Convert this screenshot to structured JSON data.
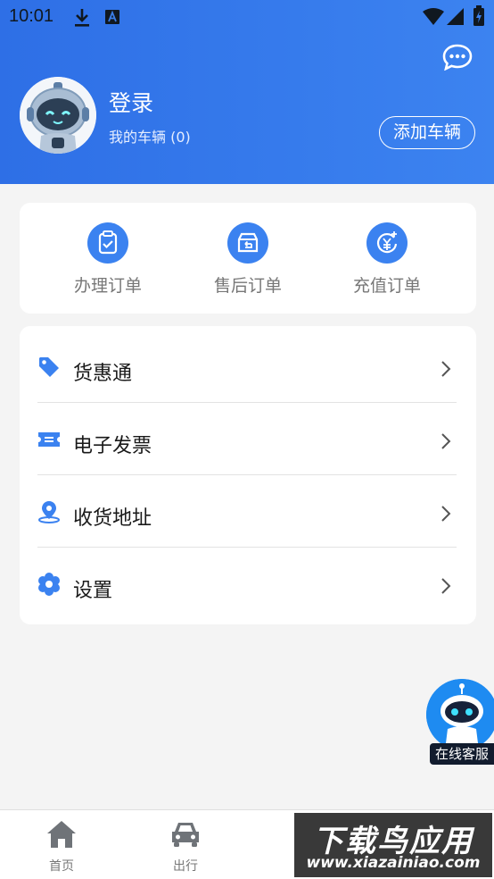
{
  "status_bar": {
    "time": "10:01"
  },
  "profile": {
    "login_label": "登录",
    "my_vehicles": "我的车辆 (0)",
    "add_vehicle_button": "添加车辆"
  },
  "orders": [
    {
      "label": "办理订单",
      "icon": "clipboard-check-icon"
    },
    {
      "label": "售后订单",
      "icon": "return-box-icon"
    },
    {
      "label": "充值订单",
      "icon": "yen-coin-icon"
    }
  ],
  "menu": [
    {
      "label": "货惠通",
      "icon": "tag-icon"
    },
    {
      "label": "电子发票",
      "icon": "ticket-icon"
    },
    {
      "label": "收货地址",
      "icon": "location-pin-icon"
    },
    {
      "label": "设置",
      "icon": "settings-flower-icon"
    }
  ],
  "floating_service": {
    "label": "在线客服"
  },
  "bottom_nav": [
    {
      "label": "首页",
      "icon": "home-icon"
    },
    {
      "label": "出行",
      "icon": "car-icon"
    }
  ],
  "watermark": {
    "line1": "下载鸟应用",
    "line2": "www.xiazainiao.com"
  },
  "colors": {
    "accent": "#3b82f0",
    "header_start": "#2e6fe6",
    "header_end": "#3c83f0"
  }
}
